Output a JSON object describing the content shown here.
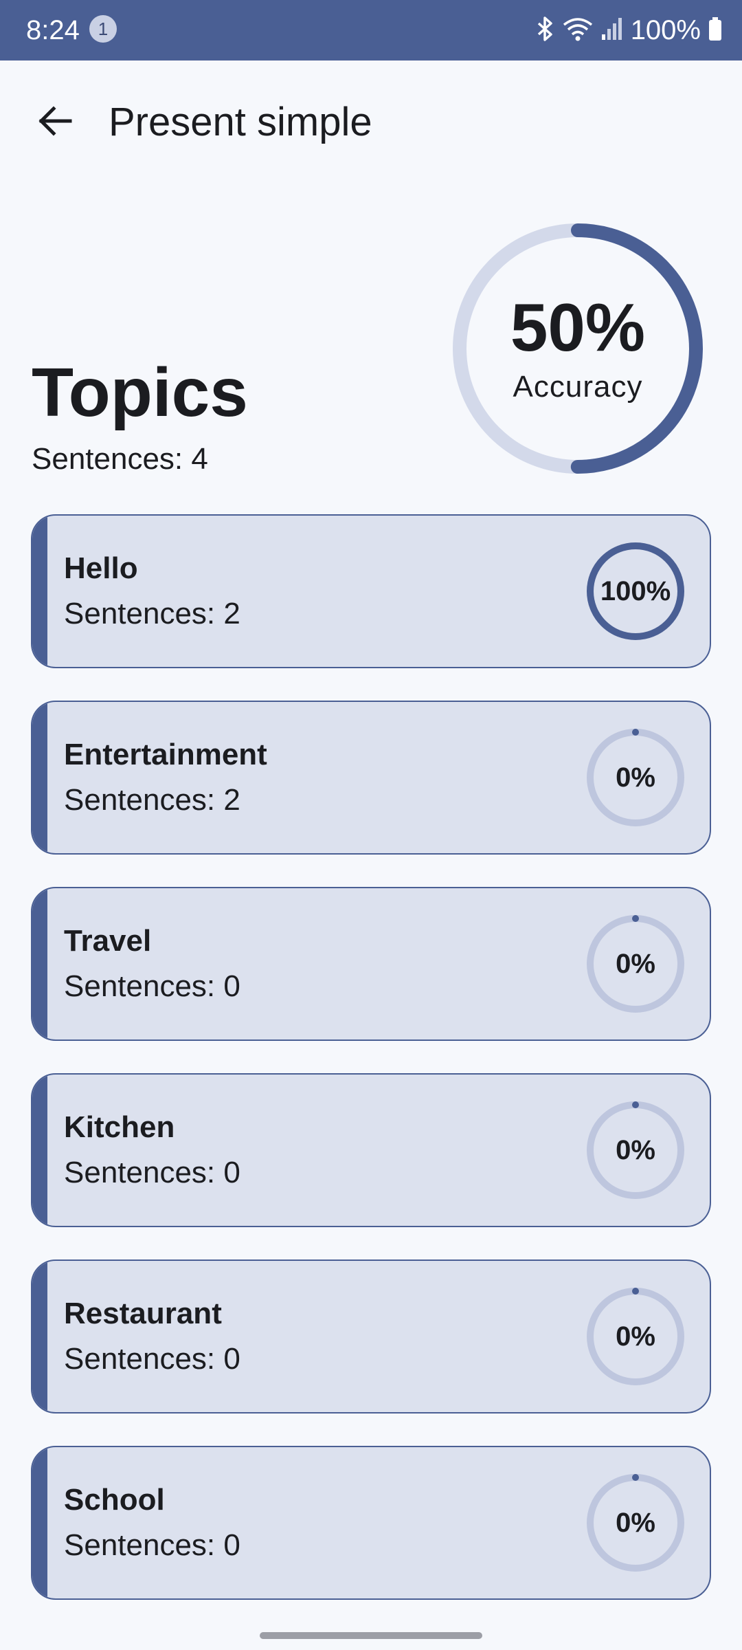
{
  "status_bar": {
    "time": "8:24",
    "notification_count": "1",
    "battery": "100%",
    "icons": [
      "bluetooth-icon",
      "wifi-icon",
      "signal-icon",
      "battery-icon"
    ]
  },
  "app_bar": {
    "back_icon": "arrow-left-icon",
    "title": "Present simple"
  },
  "header": {
    "title": "Topics",
    "sentences": "Sentences: 4"
  },
  "accuracy": {
    "value": "50%",
    "label": "Accuracy",
    "fraction": 0.5
  },
  "topics": [
    {
      "name": "Hello",
      "sentences": "Sentences: 2",
      "percent": "100%",
      "fraction": 1.0
    },
    {
      "name": "Entertainment",
      "sentences": "Sentences: 2",
      "percent": "0%",
      "fraction": 0.0
    },
    {
      "name": "Travel",
      "sentences": "Sentences: 0",
      "percent": "0%",
      "fraction": 0.0
    },
    {
      "name": "Kitchen",
      "sentences": "Sentences: 0",
      "percent": "0%",
      "fraction": 0.0
    },
    {
      "name": "Restaurant",
      "sentences": "Sentences: 0",
      "percent": "0%",
      "fraction": 0.0
    },
    {
      "name": "School",
      "sentences": "Sentences: 0",
      "percent": "0%",
      "fraction": 0.0
    }
  ],
  "colors": {
    "primary": "#4A5F94",
    "track": "#D3D9EA",
    "card_track": "#BEC6DE",
    "card_background": "#DCE1EE",
    "page_background": "#F6F8FC"
  }
}
